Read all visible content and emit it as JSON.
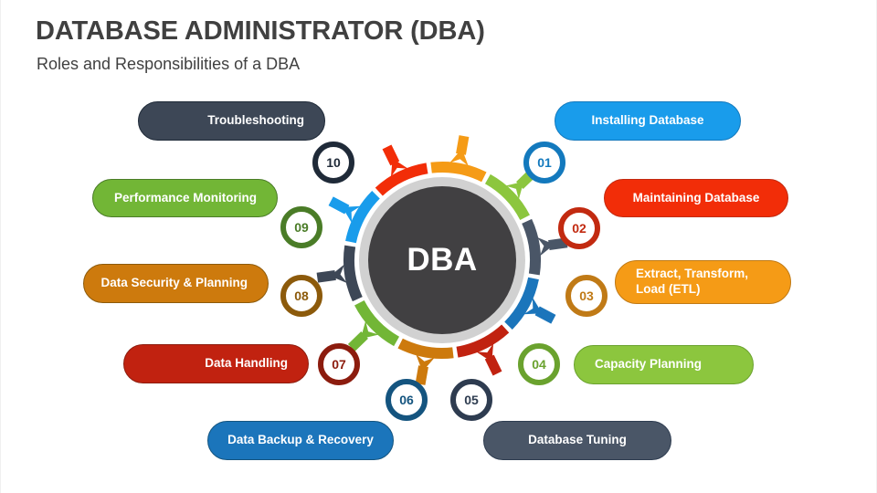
{
  "header": {
    "title": "DATABASE ADMINISTRATOR (DBA)",
    "subtitle": "Roles and Responsibilities of a DBA"
  },
  "center": {
    "label": "DBA",
    "disc_color": "#414042",
    "ring_color": "#d1d1d1"
  },
  "colors": {
    "background": "#ffffff",
    "title": "#404040"
  },
  "items": [
    {
      "number": "01",
      "label": "Installing Database",
      "pill_color": "#199ceb",
      "pill_border": "#1379bd",
      "badge_color": "#1379bd",
      "arc_color": "#199ceb",
      "align": "center"
    },
    {
      "number": "02",
      "label": "Maintaining Database",
      "pill_color": "#f22d08",
      "pill_border": "#c22a10",
      "badge_color": "#c22a10",
      "arc_color": "#f22d08",
      "align": "center"
    },
    {
      "number": "03",
      "label": "Extract, Transform,\nLoad (ETL)",
      "pill_color": "#f59b16",
      "pill_border": "#c07a16",
      "badge_color": "#c07a16",
      "arc_color": "#f59b16",
      "align": "left"
    },
    {
      "number": "04",
      "label": "Capacity Planning",
      "pill_color": "#8cc63e",
      "pill_border": "#6aa22e",
      "badge_color": "#6aa22e",
      "arc_color": "#8cc63e",
      "align": "left"
    },
    {
      "number": "05",
      "label": "Database Tuning",
      "pill_color": "#4a5667",
      "pill_border": "#2e3c50",
      "badge_color": "#2e3c50",
      "arc_color": "#4a5667",
      "align": "center"
    },
    {
      "number": "06",
      "label": "Data Backup & Recovery",
      "pill_color": "#1b75bb",
      "pill_border": "#14547f",
      "badge_color": "#14547f",
      "arc_color": "#1b75bb",
      "align": "center"
    },
    {
      "number": "07",
      "label": "Data Handling",
      "pill_color": "#c12210",
      "pill_border": "#8c1c0e",
      "badge_color": "#8c1c0e",
      "arc_color": "#c12210",
      "align": "right"
    },
    {
      "number": "08",
      "label": "Data Security & Planning",
      "pill_color": "#cd7a0d",
      "pill_border": "#8c5a0b",
      "badge_color": "#8c5a0b",
      "arc_color": "#cd7a0d",
      "align": "right"
    },
    {
      "number": "09",
      "label": "Performance Monitoring",
      "pill_color": "#72b636",
      "pill_border": "#4a7c27",
      "badge_color": "#4a7c27",
      "arc_color": "#72b636",
      "align": "right"
    },
    {
      "number": "10",
      "label": "Troubleshooting",
      "pill_color": "#3d4756",
      "pill_border": "#1f2a38",
      "badge_color": "#1f2a38",
      "arc_color": "#3d4756",
      "align": "right"
    }
  ]
}
